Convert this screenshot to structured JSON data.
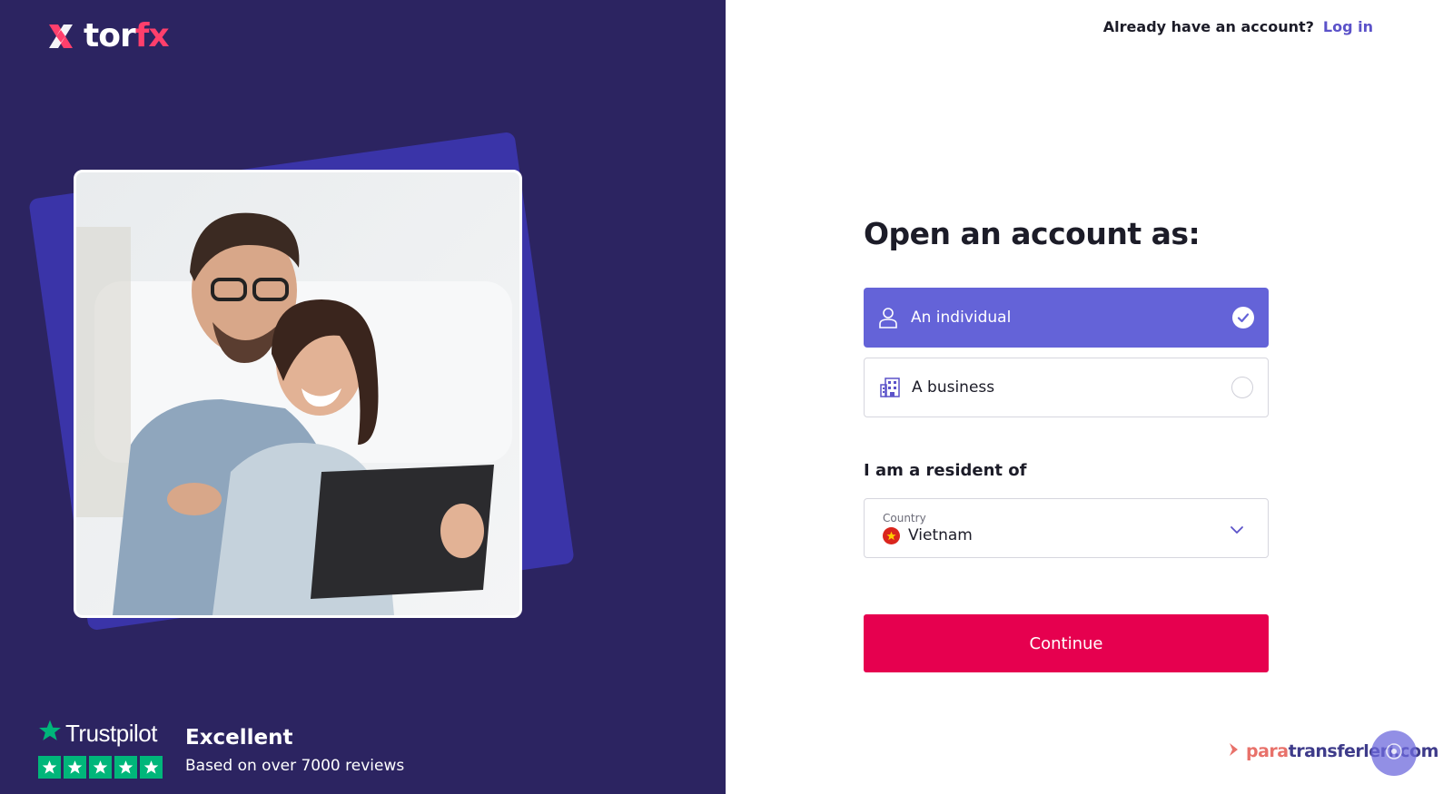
{
  "brand": {
    "logo_part1": "tor",
    "logo_part2": "fx",
    "accent_color": "#ff3f6c",
    "panel_color": "#2c2461"
  },
  "header": {
    "prompt": "Already have an account?",
    "login_label": "Log in"
  },
  "form": {
    "title": "Open an account as:",
    "options": [
      {
        "label": "An individual",
        "icon": "person-icon",
        "selected": true
      },
      {
        "label": "A business",
        "icon": "building-icon",
        "selected": false
      }
    ],
    "resident_label": "I am a resident of",
    "country": {
      "caption": "Country",
      "value": "Vietnam",
      "flag": "vietnam-flag-icon"
    },
    "continue_label": "Continue",
    "selected_color": "#6463d8",
    "button_color": "#e6004f"
  },
  "trustpilot": {
    "brand": "Trustpilot",
    "stars": 5,
    "rating_text": "Excellent",
    "reviews_text": "Based on over 7000 reviews"
  },
  "watermark": {
    "part1": "para",
    "part2": "transferleri.com"
  }
}
